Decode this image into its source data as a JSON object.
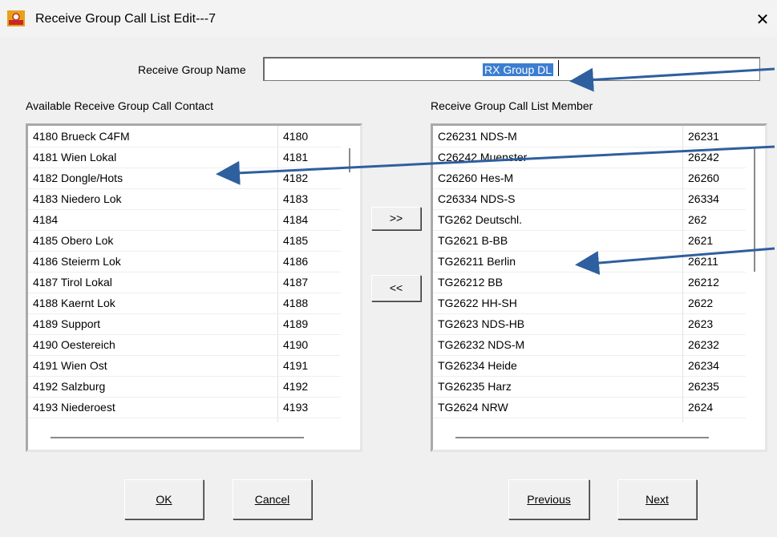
{
  "window": {
    "title": "Receive Group Call List Edit---7",
    "close_glyph": "✕"
  },
  "group_name": {
    "label": "Receive Group Name",
    "value": "RX Group DL"
  },
  "available": {
    "label": "Available Receive Group Call Contact",
    "rows": [
      [
        "4180 Brueck C4FM",
        "4180"
      ],
      [
        "4181 Wien Lokal",
        "4181"
      ],
      [
        "4182 Dongle/Hots",
        "4182"
      ],
      [
        "4183 Niedero Lok",
        "4183"
      ],
      [
        "4184",
        "4184"
      ],
      [
        "4185 Obero Lok",
        "4185"
      ],
      [
        "4186 Steierm Lok",
        "4186"
      ],
      [
        "4187 Tirol Lokal",
        "4187"
      ],
      [
        "4188 Kaernt Lok",
        "4188"
      ],
      [
        "4189 Support",
        "4189"
      ],
      [
        "4190 Oestereich",
        "4190"
      ],
      [
        "4191 Wien Ost",
        "4191"
      ],
      [
        "4192 Salzburg",
        "4192"
      ],
      [
        "4193 Niederoest",
        "4193"
      ]
    ]
  },
  "members": {
    "label": "Receive Group Call List Member",
    "rows": [
      [
        "C26231 NDS-M",
        "26231"
      ],
      [
        "C26242 Muenster",
        "26242"
      ],
      [
        "C26260 Hes-M",
        "26260"
      ],
      [
        "C26334 NDS-S",
        "26334"
      ],
      [
        "TG262 Deutschl.",
        "262"
      ],
      [
        "TG2621 B-BB",
        "2621"
      ],
      [
        "TG26211 Berlin",
        "26211"
      ],
      [
        "TG26212 BB",
        "26212"
      ],
      [
        "TG2622 HH-SH",
        "2622"
      ],
      [
        "TG2623 NDS-HB",
        "2623"
      ],
      [
        "TG26232 NDS-M",
        "26232"
      ],
      [
        "TG26234 Heide",
        "26234"
      ],
      [
        "TG26235 Harz",
        "26235"
      ],
      [
        "TG2624 NRW",
        "2624"
      ]
    ]
  },
  "buttons": {
    "add": ">>",
    "remove": "<<",
    "ok": "OK",
    "cancel": "Cancel",
    "previous": "Previous",
    "next": "Next"
  },
  "colors": {
    "selection": "#3b7ed1",
    "annotation_arrow": "#2e5f9e"
  },
  "icons": {
    "app": "app-icon",
    "close": "close-icon"
  }
}
